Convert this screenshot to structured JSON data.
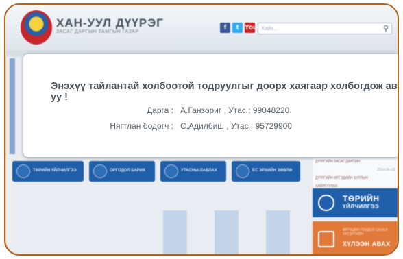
{
  "header": {
    "title": "ХАН-УУЛ ДҮҮРЭГ",
    "subtitle": "ЗАСАГ ДАРГЫН ТАМГЫН ГАЗАР",
    "search_placeholder": "Хайх...",
    "social": [
      "f",
      "t",
      "You"
    ]
  },
  "modal": {
    "heading": "Энэхүү тайлантай холбоотой тодруулгыг доорх хаягаар холбогдож авна уу !",
    "contacts": [
      {
        "label": "Дарга :",
        "value": "А.Ганзориг , Утас : 99048220"
      },
      {
        "label": "Нягтлан бодогч :",
        "value": "С.Адилбиш , Утас : 95729900"
      }
    ]
  },
  "tiles": [
    {
      "label": "ТӨРИЙН ҮЙЛЧИЛГЭЭ"
    },
    {
      "label": "ОРГОДОЛ БАРИХ"
    },
    {
      "label": "УТАСНЫ ЛАВЛАХ"
    },
    {
      "label": "ЕС ЭРХИЙН ЗӨВЛӨ"
    }
  ],
  "news": {
    "items": [
      "ДҮҮРГИЙН ЗАСАГ ДАРГЫН",
      "2014-06-18",
      "ДҮҮРГИЙН ИРГЭДИЙН ХУРЛЫН",
      "ХАЙЛГУУЛАХ"
    ]
  },
  "side_buttons": {
    "public_service": {
      "title": "ТӨРИЙН",
      "sub": "ҮЙЛЧИЛГЭЭ"
    },
    "request": {
      "small": "ӨРГӨДӨЛ ГОМДОЛ САНАЛ ХҮСЭЛТИЙН",
      "title": "ХҮЛЭЭН АВАХ"
    }
  },
  "colors": {
    "brand_blue": "#1f5ea8",
    "orange": "#e0793a",
    "frame": "#b0621f"
  }
}
